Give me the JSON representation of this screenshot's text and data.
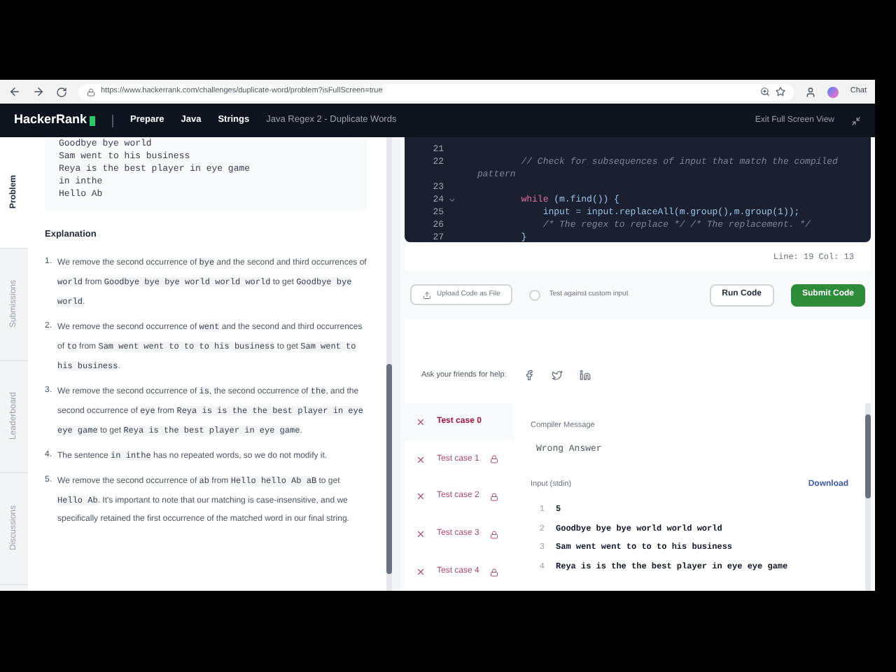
{
  "browser": {
    "url": "https://www.hackerrank.com/challenges/duplicate-word/problem?isFullScreen=true",
    "chat_label": "Chat"
  },
  "header": {
    "logo": "HackerRank",
    "breadcrumbs": [
      {
        "label": "Prepare",
        "current": false
      },
      {
        "label": "Java",
        "current": false
      },
      {
        "label": "Strings",
        "current": false
      },
      {
        "label": "Java Regex 2 - Duplicate Words",
        "current": true
      }
    ],
    "exit_label": "Exit Full Screen View"
  },
  "side_tabs": [
    {
      "label": "Problem",
      "selected": true
    },
    {
      "label": "Submissions",
      "selected": false
    },
    {
      "label": "Leaderboard",
      "selected": false
    },
    {
      "label": "Discussions",
      "selected": false
    }
  ],
  "sample_output": [
    "Goodbye bye world",
    "Sam went to his business",
    "Reya is the best player in eye game",
    "in inthe",
    "Hello Ab"
  ],
  "explanation": {
    "title": "Explanation",
    "items": [
      {
        "number": "1.",
        "parts": [
          {
            "kind": "text",
            "text": "We remove the second occurrence of "
          },
          {
            "kind": "code",
            "text": "bye"
          },
          {
            "kind": "text",
            "text": " and the second and third occurrences of "
          },
          {
            "kind": "code",
            "text": "world"
          },
          {
            "kind": "text",
            "text": " from "
          },
          {
            "kind": "code",
            "text": "Goodbye bye bye world world world"
          },
          {
            "kind": "text",
            "text": " to get "
          },
          {
            "kind": "code",
            "text": "Goodbye bye world"
          },
          {
            "kind": "text",
            "text": "."
          }
        ]
      },
      {
        "number": "2.",
        "parts": [
          {
            "kind": "text",
            "text": "We remove the second occurrence of "
          },
          {
            "kind": "code",
            "text": "went"
          },
          {
            "kind": "text",
            "text": " and the second and third occurrences of "
          },
          {
            "kind": "code",
            "text": "to"
          },
          {
            "kind": "text",
            "text": " from "
          },
          {
            "kind": "code",
            "text": "Sam went went to to to his business"
          },
          {
            "kind": "text",
            "text": " to get "
          },
          {
            "kind": "code",
            "text": "Sam went to his business"
          },
          {
            "kind": "text",
            "text": "."
          }
        ]
      },
      {
        "number": "3.",
        "parts": [
          {
            "kind": "text",
            "text": "We remove the second occurrence of "
          },
          {
            "kind": "code",
            "text": "is"
          },
          {
            "kind": "text",
            "text": ", the second occurrence of "
          },
          {
            "kind": "code",
            "text": "the"
          },
          {
            "kind": "text",
            "text": ", and the second occurrence of "
          },
          {
            "kind": "code",
            "text": "eye"
          },
          {
            "kind": "text",
            "text": " from "
          },
          {
            "kind": "code",
            "text": "Reya is is the the best player in eye eye game"
          },
          {
            "kind": "text",
            "text": " to get "
          },
          {
            "kind": "code",
            "text": "Reya is the best player in eye game"
          },
          {
            "kind": "text",
            "text": "."
          }
        ]
      },
      {
        "number": "4.",
        "parts": [
          {
            "kind": "text",
            "text": "The sentence "
          },
          {
            "kind": "code",
            "text": "in inthe"
          },
          {
            "kind": "text",
            "text": " has no repeated words, so we do not modify it."
          }
        ]
      },
      {
        "number": "5.",
        "parts": [
          {
            "kind": "text",
            "text": "We remove the second occurrence of "
          },
          {
            "kind": "code",
            "text": "ab"
          },
          {
            "kind": "text",
            "text": " from "
          },
          {
            "kind": "code",
            "text": "Hello hello Ab aB"
          },
          {
            "kind": "text",
            "text": " to get "
          },
          {
            "kind": "code",
            "text": "Hello Ab"
          },
          {
            "kind": "text",
            "text": ". It's important to note that our matching is case-insensitive, and we specifically retained the first occurrence of the matched word in our final string."
          }
        ]
      }
    ]
  },
  "editor": {
    "lines": [
      {
        "number": "21",
        "fold": false
      },
      {
        "number": "22",
        "fold": false,
        "parts": [
          {
            "kind": "comment",
            "text": "        // Check for subsequences of input that match the compiled pattern"
          }
        ]
      },
      {
        "number": "23",
        "fold": false
      },
      {
        "number": "24",
        "fold": true,
        "parts": [
          {
            "kind": "keyword",
            "text": "        while"
          },
          {
            "kind": "code",
            "text": " (m.find()) {"
          }
        ]
      },
      {
        "number": "25",
        "fold": false,
        "parts": [
          {
            "kind": "code",
            "text": "            input = input.replaceAll(m.group(),m.group(1));"
          }
        ]
      },
      {
        "number": "26",
        "fold": false,
        "parts": [
          {
            "kind": "comment",
            "text": "            /* The regex to replace */ /* The replacement. */"
          }
        ]
      },
      {
        "number": "27",
        "fold": false,
        "parts": [
          {
            "kind": "code",
            "text": "        }"
          }
        ]
      }
    ],
    "position": "Line: 19 Col: 13"
  },
  "actions": {
    "upload": "Upload Code as File",
    "custom_input": {
      "label": "Test against custom input",
      "checked": false
    },
    "run": "Run Code",
    "submit": "Submit Code"
  },
  "share": {
    "label": "Ask your friends for help:"
  },
  "test_cases": [
    {
      "label": "Test case 0",
      "selected": true,
      "locked": false
    },
    {
      "label": "Test case 1",
      "selected": false,
      "locked": true
    },
    {
      "label": "Test case 2",
      "selected": false,
      "locked": true
    },
    {
      "label": "Test case 3",
      "selected": false,
      "locked": true
    },
    {
      "label": "Test case 4",
      "selected": false,
      "locked": true
    }
  ],
  "result": {
    "compiler_label": "Compiler Message",
    "compiler_message": "Wrong Answer",
    "input_label": "Input (stdin)",
    "download": "Download",
    "input_lines": [
      {
        "number": "1",
        "text": "5"
      },
      {
        "number": "2",
        "text": "Goodbye bye bye world world world"
      },
      {
        "number": "3",
        "text": "Sam went went to to to his business"
      },
      {
        "number": "4",
        "text": "Reya is is the the best player in eye eye game"
      }
    ]
  }
}
